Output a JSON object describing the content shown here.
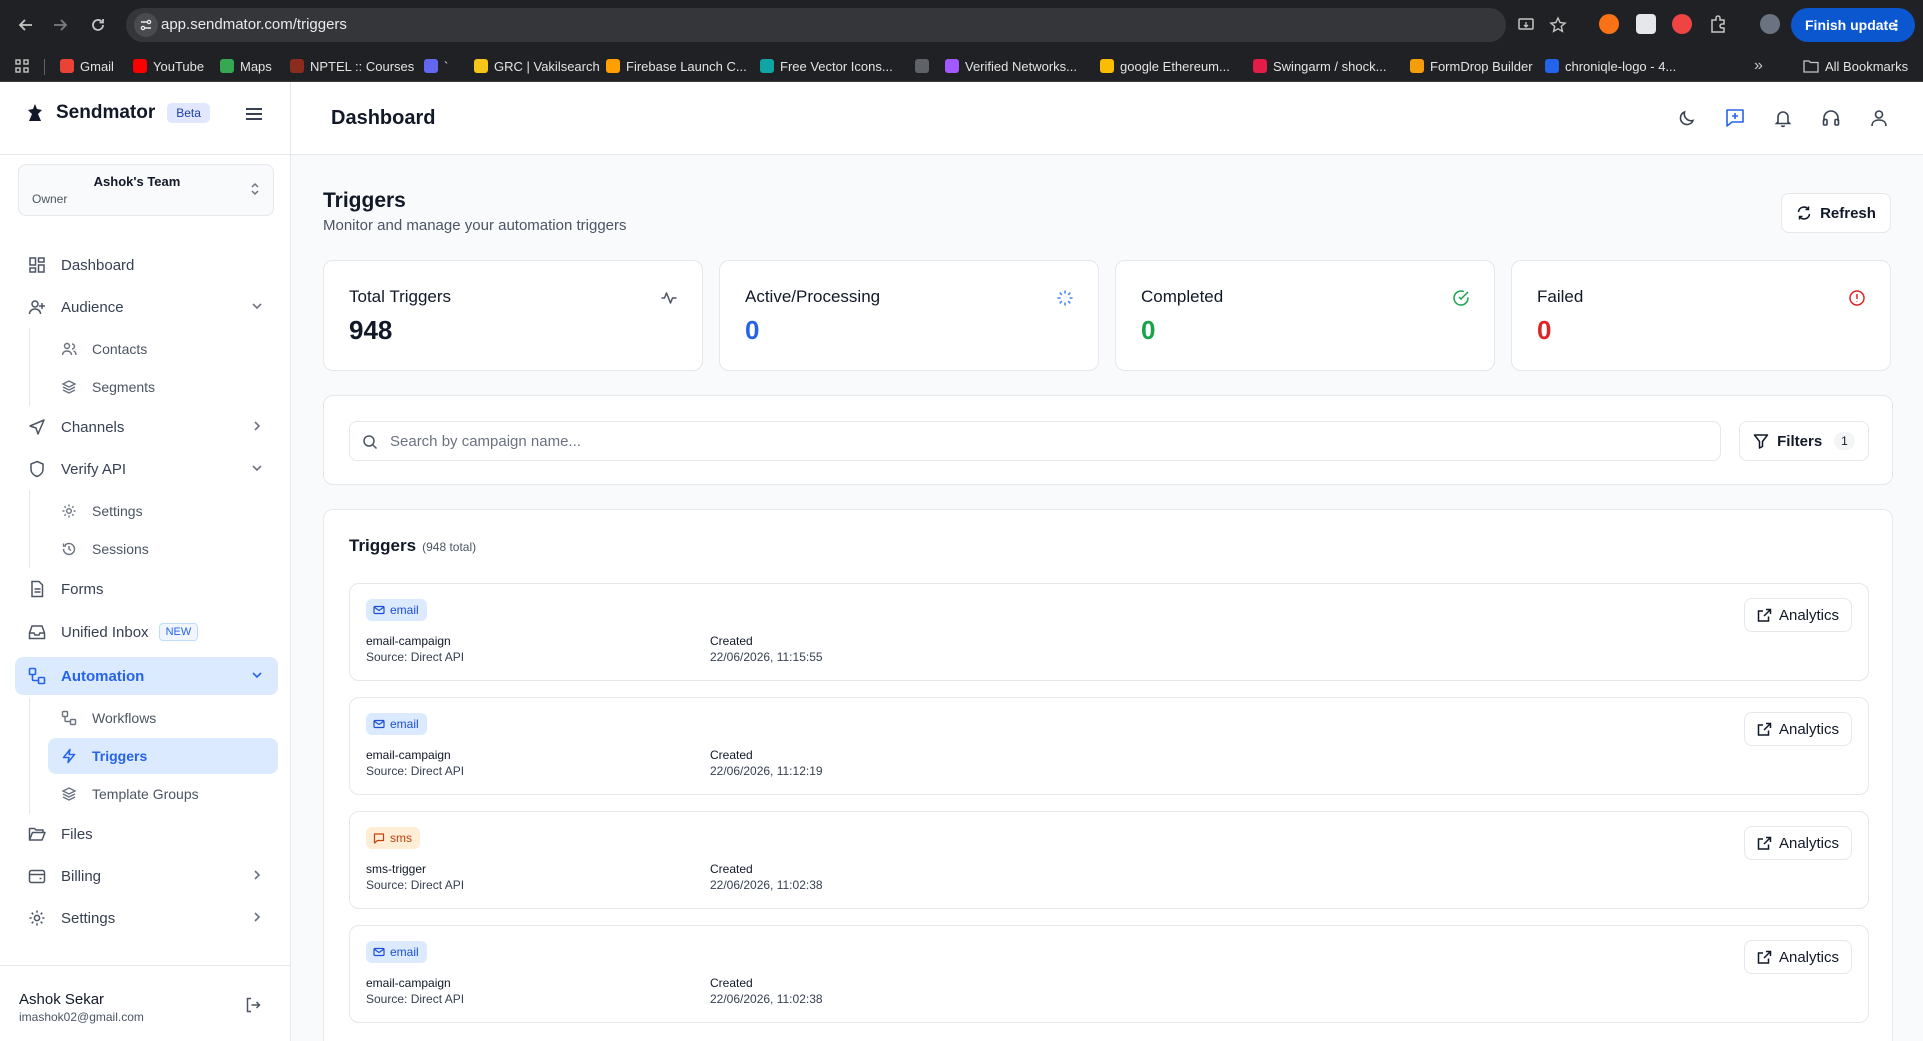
{
  "browser": {
    "url": "app.sendmator.com/triggers",
    "finish_update": "Finish update",
    "bookmarks": [
      {
        "label": "Gmail",
        "color": "#ea4335"
      },
      {
        "label": "YouTube",
        "color": "#ff0000"
      },
      {
        "label": "Maps",
        "color": "#34a853"
      },
      {
        "label": "NPTEL :: Courses",
        "color": "#8b2c1e"
      },
      {
        "label": "`",
        "color": "#6366f1"
      },
      {
        "label": "GRC | Vakilsearch",
        "color": "#f5c518"
      },
      {
        "label": "Firebase Launch C...",
        "color": "#ffa000"
      },
      {
        "label": "Free Vector Icons...",
        "color": "#0ea5a4"
      },
      {
        "label": "",
        "color": "#5f6368"
      },
      {
        "label": "Verified Networks...",
        "color": "#a259ff"
      },
      {
        "label": "google Ethereum...",
        "color": "#fbbc04"
      },
      {
        "label": "Swingarm / shock...",
        "color": "#e11d48"
      },
      {
        "label": "FormDrop Builder",
        "color": "#f59e0b"
      },
      {
        "label": "chroniqle-logo - 4...",
        "color": "#2563eb"
      }
    ],
    "all_bookmarks": "All Bookmarks"
  },
  "sidebar": {
    "brand": "Sendmator",
    "beta": "Beta",
    "team_name": "Ashok's Team",
    "team_role": "Owner",
    "items": {
      "dashboard": "Dashboard",
      "audience": "Audience",
      "contacts": "Contacts",
      "segments": "Segments",
      "channels": "Channels",
      "verify_api": "Verify API",
      "settings_sub": "Settings",
      "sessions": "Sessions",
      "forms": "Forms",
      "unified_inbox": "Unified Inbox",
      "new_badge": "NEW",
      "automation": "Automation",
      "workflows": "Workflows",
      "triggers": "Triggers",
      "template_groups": "Template Groups",
      "files": "Files",
      "billing": "Billing",
      "settings": "Settings"
    },
    "user": {
      "name": "Ashok Sekar",
      "email": "imashok02@gmail.com"
    }
  },
  "header": {
    "title": "Dashboard"
  },
  "page": {
    "title": "Triggers",
    "subtitle": "Monitor and manage your automation triggers",
    "refresh": "Refresh"
  },
  "stats": [
    {
      "label": "Total Triggers",
      "value": "948",
      "color": "#111827",
      "icon": "activity-icon"
    },
    {
      "label": "Active/Processing",
      "value": "0",
      "color": "#2563eb",
      "icon": "loader-icon"
    },
    {
      "label": "Completed",
      "value": "0",
      "color": "#16a34a",
      "icon": "check-circle-icon"
    },
    {
      "label": "Failed",
      "value": "0",
      "color": "#dc2626",
      "icon": "alert-circle-icon"
    }
  ],
  "search": {
    "placeholder": "Search by campaign name...",
    "value": "",
    "filters_label": "Filters",
    "filters_count": "1"
  },
  "triggers": {
    "title": "Triggers",
    "count": "(948 total)",
    "analytics_label": "Analytics",
    "created_label": "Created",
    "rows": [
      {
        "type": "email",
        "name": "email-campaign",
        "source": "Source: Direct API",
        "created": "22/06/2026, 11:15:55"
      },
      {
        "type": "email",
        "name": "email-campaign",
        "source": "Source: Direct API",
        "created": "22/06/2026, 11:12:19"
      },
      {
        "type": "sms",
        "name": "sms-trigger",
        "source": "Source: Direct API",
        "created": "22/06/2026, 11:02:38"
      },
      {
        "type": "email",
        "name": "email-campaign",
        "source": "Source: Direct API",
        "created": "22/06/2026, 11:02:38"
      }
    ]
  }
}
